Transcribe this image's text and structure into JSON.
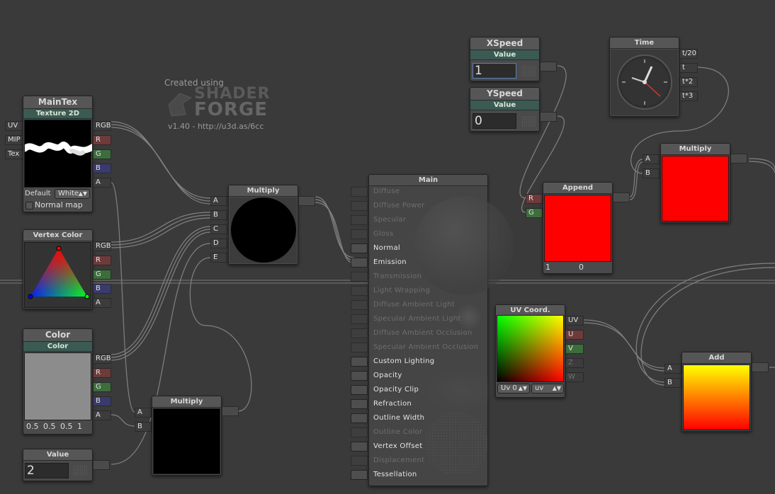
{
  "logo": {
    "created_using": "Created using",
    "line1": "SHADER",
    "line2": "FORGE",
    "version": "v1.40 - http://u3d.as/6cc"
  },
  "maintex": {
    "title": "MainTex",
    "subtitle": "Texture 2D",
    "inputs": [
      "UV",
      "MIP",
      "Tex"
    ],
    "outputs": [
      "RGB",
      "R",
      "G",
      "B",
      "A"
    ],
    "default_label": "Default",
    "default_value": "White",
    "normal_map_label": "Normal map"
  },
  "vertex_color": {
    "title": "Vertex Color",
    "outputs": [
      "RGB",
      "R",
      "G",
      "B",
      "A"
    ]
  },
  "color_node": {
    "title": "Color",
    "subtitle": "Color",
    "outputs": [
      "RGB",
      "R",
      "G",
      "B",
      "A"
    ],
    "values": [
      "0.5",
      "0.5",
      "0.5",
      "1"
    ],
    "swatch_color": "#8c8c8c"
  },
  "value_node": {
    "title": "Value",
    "value": "2"
  },
  "multiply_main": {
    "title": "Multiply",
    "inputs": [
      "A",
      "B",
      "C",
      "D",
      "E"
    ]
  },
  "multiply_bottom": {
    "title": "Multiply",
    "inputs": [
      "A",
      "B"
    ]
  },
  "xspeed": {
    "title": "XSpeed",
    "subtitle": "Value",
    "value": "1"
  },
  "yspeed": {
    "title": "YSpeed",
    "subtitle": "Value",
    "value": "0"
  },
  "time_node": {
    "title": "Time",
    "outputs": [
      "t/20",
      "t",
      "t*2",
      "t*3"
    ]
  },
  "append": {
    "title": "Append",
    "inputs": [
      "R",
      "G"
    ],
    "values": [
      "1",
      "0"
    ],
    "preview_color": "#ff0000"
  },
  "multiply_top_right": {
    "title": "Multiply",
    "inputs": [
      "A",
      "B"
    ],
    "preview_color": "#ff0000"
  },
  "uv_coord": {
    "title": "UV Coord.",
    "outputs": [
      "UV",
      "U",
      "V",
      "Z",
      "W"
    ],
    "channel_dropdown": "Uv 0",
    "mode_dropdown": "uv"
  },
  "add": {
    "title": "Add",
    "inputs": [
      "A",
      "B"
    ]
  },
  "main": {
    "title": "Main",
    "rows": [
      {
        "label": "Diffuse",
        "enabled": false
      },
      {
        "label": "Diffuse Power",
        "enabled": false
      },
      {
        "label": "Specular",
        "enabled": false
      },
      {
        "label": "Gloss",
        "enabled": false
      },
      {
        "label": "Normal",
        "enabled": true
      },
      {
        "label": "Emission",
        "enabled": true
      },
      {
        "label": "Transmission",
        "enabled": false
      },
      {
        "label": "Light Wrapping",
        "enabled": false
      },
      {
        "label": "Diffuse Ambient Light",
        "enabled": false
      },
      {
        "label": "Specular Ambient Light",
        "enabled": false
      },
      {
        "label": "Diffuse Ambient Occlusion",
        "enabled": false
      },
      {
        "label": "Specular Ambient Occlusion",
        "enabled": false
      },
      {
        "label": "Custom Lighting",
        "enabled": true
      },
      {
        "label": "Opacity",
        "enabled": true
      },
      {
        "label": "Opacity Clip",
        "enabled": true
      },
      {
        "label": "Refraction",
        "enabled": true
      },
      {
        "label": "Outline Width",
        "enabled": true
      },
      {
        "label": "Outline Color",
        "enabled": false
      },
      {
        "label": "Vertex Offset",
        "enabled": true
      },
      {
        "label": "Displacement",
        "enabled": false
      },
      {
        "label": "Tessellation",
        "enabled": true
      }
    ]
  },
  "colors": {
    "canvas": "#3a3a3a",
    "node_header": "#3a5a52",
    "wire": "#9a9a9a",
    "red_preview": "#ff0000"
  }
}
